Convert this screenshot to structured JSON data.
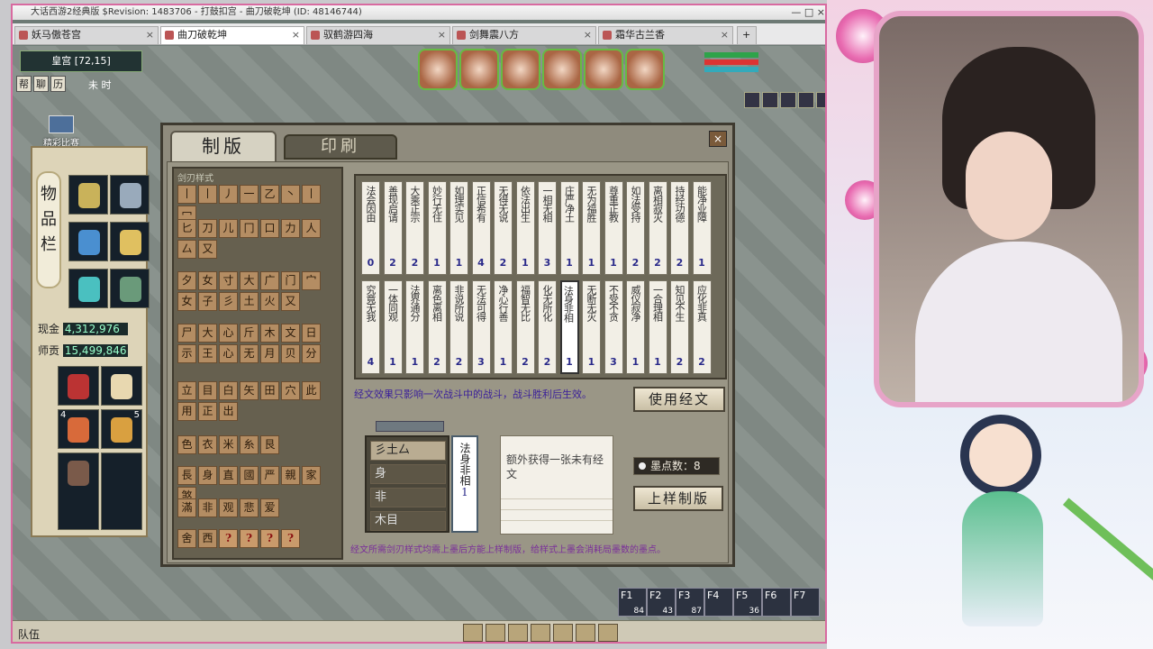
{
  "window": {
    "title": "大话西游2经典版 $Revision: 1483706 - 打鼓扣宫 - 曲刀破乾坤 (ID: 48146744)",
    "controls": "— □ ×"
  },
  "tabs": [
    {
      "label": "妖马傲苍宫",
      "active": false
    },
    {
      "label": "曲刀破乾坤",
      "active": true
    },
    {
      "label": "驭鹤游四海",
      "active": false
    },
    {
      "label": "剑舞震八方",
      "active": false
    },
    {
      "label": "霜华古兰香",
      "active": false
    }
  ],
  "tab_close": "×",
  "tab_add": "+",
  "hud": {
    "location": "皇宫 [72,15]",
    "mini_buttons": [
      "帮",
      "聊",
      "历"
    ],
    "time": "未 时",
    "event": "精彩比赛"
  },
  "inventory": {
    "title": "物品栏",
    "money_label": "现金",
    "money": "4,312,976",
    "contrib_label": "师贡",
    "contrib": "15,499,846",
    "counts": [
      "4",
      "5"
    ]
  },
  "dialog": {
    "tab_make": "制版",
    "tab_print": "印刷",
    "close": "×",
    "stroke_panel_title": "剑刃样式",
    "stroke_rows": [
      [
        "丨",
        "丨",
        "丿",
        "一",
        "乙",
        "丶",
        "丨",
        "冖"
      ],
      [
        "匕",
        "刀",
        "儿",
        "冂",
        "口",
        "力",
        "人",
        "厶",
        "又"
      ],
      [
        "夕",
        "女",
        "寸",
        "大",
        "广",
        "门",
        "宀",
        "女",
        "子",
        "彡",
        "土",
        "火",
        "又"
      ],
      [
        "尸",
        "大",
        "心",
        "斤",
        "木",
        "文",
        "日",
        "示",
        "王",
        "心",
        "无",
        "月",
        "贝",
        "分"
      ],
      [
        "立",
        "目",
        "白",
        "矢",
        "田",
        "穴",
        "此",
        "用",
        "正",
        "出"
      ],
      [
        "色",
        "衣",
        "米",
        "糸",
        "艮"
      ],
      [
        "長",
        "身",
        "直",
        "國",
        "严",
        "親",
        "家",
        "煞"
      ],
      [
        "滿",
        "非",
        "观",
        "悲",
        "爱"
      ],
      [
        "舍",
        "西",
        "?",
        "?",
        "?",
        "?"
      ]
    ],
    "cards_top": [
      {
        "text": "法会因由",
        "count": "0"
      },
      {
        "text": "善现启请",
        "count": "2"
      },
      {
        "text": "大乘正宗",
        "count": "2"
      },
      {
        "text": "妙行无住",
        "count": "1"
      },
      {
        "text": "如理实见",
        "count": "1"
      },
      {
        "text": "正信希有",
        "count": "4"
      },
      {
        "text": "无得无说",
        "count": "2"
      },
      {
        "text": "依法出生",
        "count": "1"
      },
      {
        "text": "一相无相",
        "count": "3"
      },
      {
        "text": "庄严净土",
        "count": "1"
      },
      {
        "text": "无为福胜",
        "count": "1"
      },
      {
        "text": "尊重正教",
        "count": "1"
      },
      {
        "text": "如法受持",
        "count": "2"
      },
      {
        "text": "离相寂灭",
        "count": "2"
      },
      {
        "text": "持经功德",
        "count": "2"
      },
      {
        "text": "能净业障",
        "count": "1"
      }
    ],
    "cards_bottom": [
      {
        "text": "究竟无我",
        "count": "4"
      },
      {
        "text": "一体同观",
        "count": "1"
      },
      {
        "text": "法界通分",
        "count": "1"
      },
      {
        "text": "离色离相",
        "count": "2"
      },
      {
        "text": "非说所说",
        "count": "2"
      },
      {
        "text": "无法可得",
        "count": "3"
      },
      {
        "text": "净心行善",
        "count": "1"
      },
      {
        "text": "福智无比",
        "count": "2"
      },
      {
        "text": "化无所化",
        "count": "2"
      },
      {
        "text": "法身非相",
        "count": "1"
      },
      {
        "text": "无断无灭",
        "count": "1"
      },
      {
        "text": "不受不贪",
        "count": "3"
      },
      {
        "text": "威仪寂净",
        "count": "1"
      },
      {
        "text": "一合理相",
        "count": "1"
      },
      {
        "text": "知见不生",
        "count": "2"
      },
      {
        "text": "应化非真",
        "count": "2"
      }
    ],
    "effect_text": "经文效果只影响一次战斗中的战斗，战斗胜利后生效。",
    "use_button": "使用经文",
    "compose_rows": [
      "彡土厶",
      "身",
      "非",
      "木目"
    ],
    "selected_card": {
      "text": "法身非相",
      "count": "1"
    },
    "selected_desc": "额外获得一张未有经文",
    "ink_label": "墨点数：8",
    "print_button": "上样制版",
    "hint": "经文所需剑刃样式均需上墨后方能上样制版，给样式上墨会消耗局墨数的墨点。"
  },
  "bottombar": {
    "team": "队伍"
  },
  "fkeys": [
    {
      "key": "F1",
      "n": "84"
    },
    {
      "key": "F2",
      "n": "43"
    },
    {
      "key": "F3",
      "n": "87"
    },
    {
      "key": "F4",
      "n": ""
    },
    {
      "key": "F5",
      "n": "36"
    },
    {
      "key": "F6",
      "n": ""
    },
    {
      "key": "F7",
      "n": ""
    }
  ],
  "colors": {
    "accent": "#d86aa0",
    "dialog": "#8f8b7d",
    "hint": "#7a2f9a",
    "effect": "#3a1f9a"
  }
}
